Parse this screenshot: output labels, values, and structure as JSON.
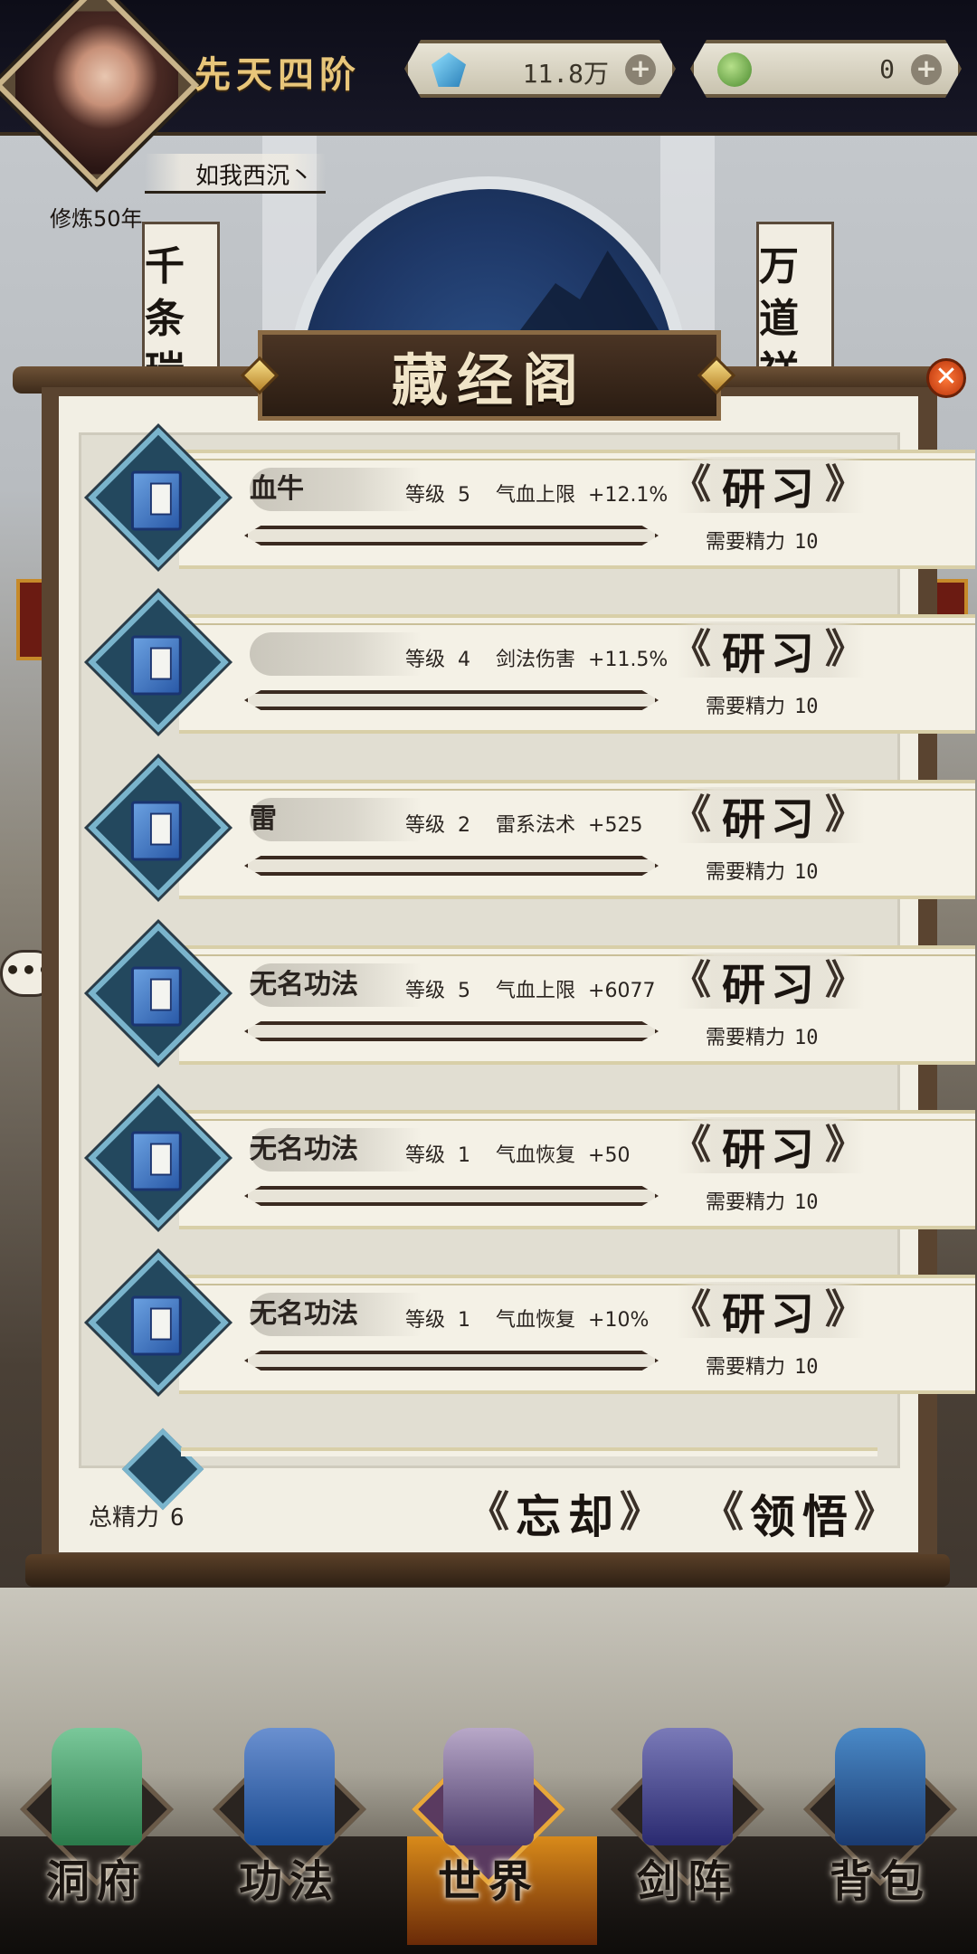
{
  "header": {
    "rank_title": "先天四阶",
    "player_name": "如我西沉丶",
    "cultivation_years": "修炼50年",
    "currencies": [
      {
        "icon": "spirit-stone-icon",
        "value": "11.8万",
        "plus": "+"
      },
      {
        "icon": "jade-icon",
        "value": "0",
        "plus": "+"
      }
    ],
    "side_signs": {
      "left": "千条瑞",
      "right": "万道祥"
    },
    "chat_bubble": "•••"
  },
  "panel": {
    "title": "藏经阁",
    "close_label": "✕",
    "study_label": "研习",
    "cost_label": "需要精力",
    "level_label": "等级",
    "rows": [
      {
        "name": "血牛",
        "level": "5",
        "effect": "气血上限",
        "bonus": "+12.1%",
        "cost": "10"
      },
      {
        "name": "",
        "level": "4",
        "effect": "剑法伤害",
        "bonus": "+11.5%",
        "cost": "10"
      },
      {
        "name": "雷",
        "level": "2",
        "effect": "雷系法术",
        "bonus": "+525",
        "cost": "10"
      },
      {
        "name": "无名功法",
        "level": "5",
        "effect": "气血上限",
        "bonus": "+6077",
        "cost": "10"
      },
      {
        "name": "无名功法",
        "level": "1",
        "effect": "气血恢复",
        "bonus": "+50",
        "cost": "10"
      },
      {
        "name": "无名功法",
        "level": "1",
        "effect": "气血恢复",
        "bonus": "+10%",
        "cost": "10"
      }
    ],
    "footer": {
      "total_energy_label": "总精力",
      "total_energy_value": "6",
      "forget_label": "忘却",
      "comprehend_label": "领悟"
    }
  },
  "nav": {
    "items": [
      {
        "label": "洞府",
        "icon": "cave-mansion-icon",
        "active": false
      },
      {
        "label": "功法",
        "icon": "technique-book-icon",
        "active": false
      },
      {
        "label": "世界",
        "icon": "world-map-icon",
        "active": true
      },
      {
        "label": "剑阵",
        "icon": "sword-array-icon",
        "active": false
      },
      {
        "label": "背包",
        "icon": "backpack-icon",
        "active": false
      }
    ]
  },
  "colors": {
    "accent_gold": "#e8c67a",
    "panel_paper": "#f2efe4",
    "badge_blue": "#23485e",
    "close_orange": "#d8501a"
  }
}
